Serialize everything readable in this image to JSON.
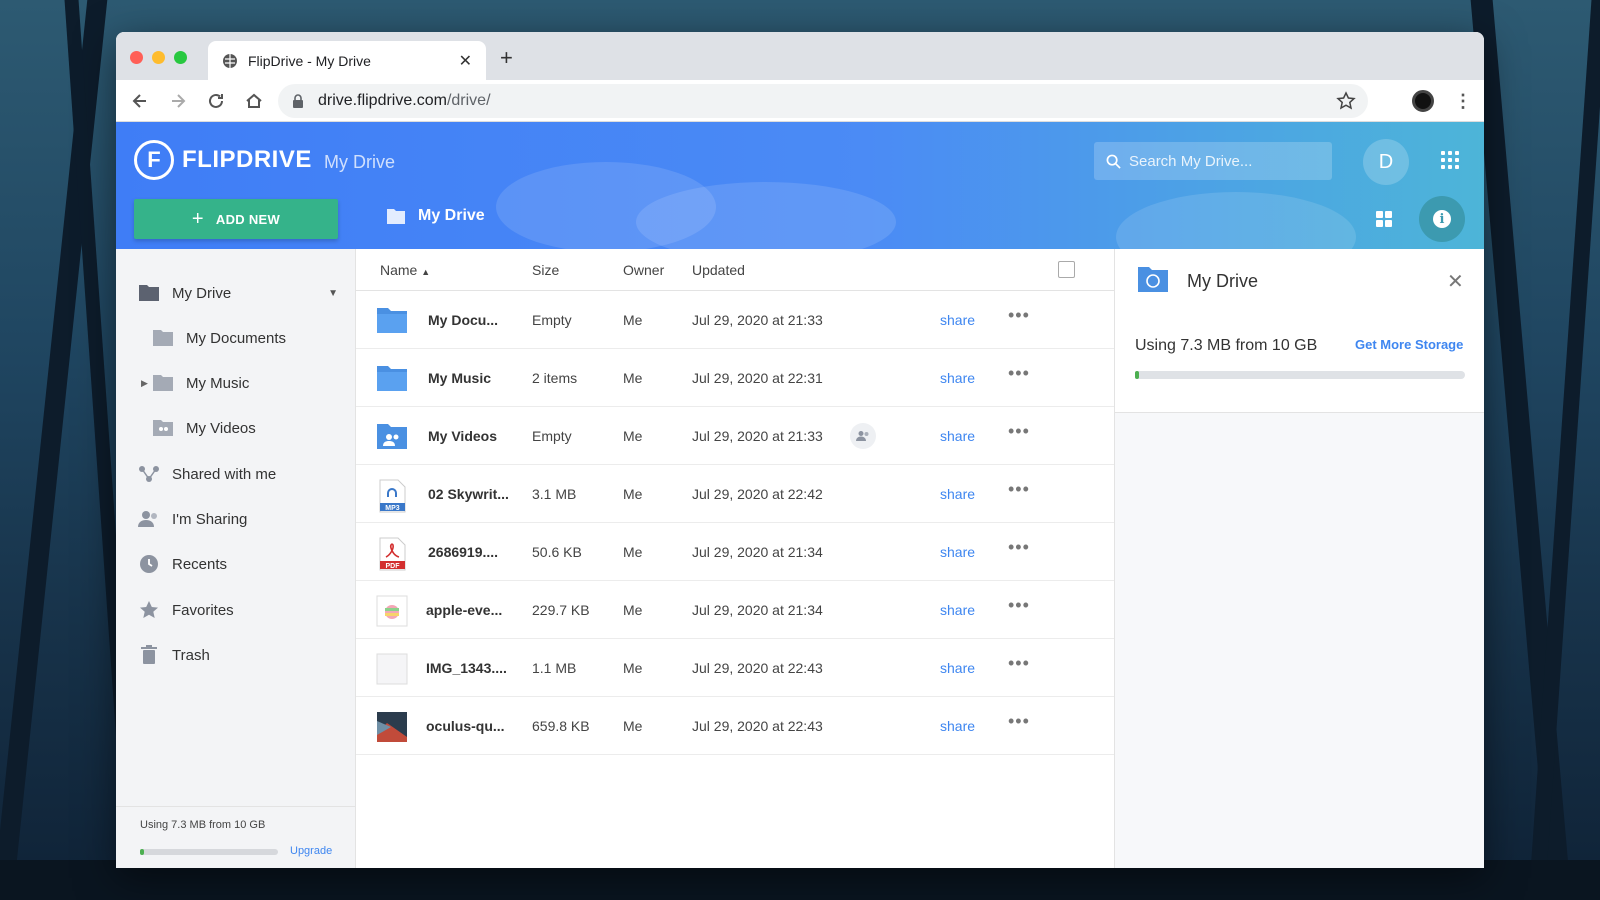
{
  "browser": {
    "tab_title": "FlipDrive - My Drive",
    "url_host": "drive.flipdrive.com",
    "url_path": "/drive/"
  },
  "app": {
    "logo_text": "FLIPDRIVE",
    "logo_glyph": "F",
    "header_title": "My Drive",
    "search_placeholder": "Search My Drive...",
    "user_initial": "D",
    "add_new_label": "ADD NEW",
    "breadcrumb": "My Drive"
  },
  "sidebar": {
    "items": [
      {
        "label": "My Drive",
        "icon": "folder-icon"
      },
      {
        "label": "My Documents",
        "icon": "folder-icon"
      },
      {
        "label": "My Music",
        "icon": "folder-icon"
      },
      {
        "label": "My Videos",
        "icon": "shared-folder-icon"
      },
      {
        "label": "Shared with me",
        "icon": "share-icon"
      },
      {
        "label": "I'm Sharing",
        "icon": "people-icon"
      },
      {
        "label": "Recents",
        "icon": "clock-icon"
      },
      {
        "label": "Favorites",
        "icon": "star-icon"
      },
      {
        "label": "Trash",
        "icon": "trash-icon"
      }
    ],
    "storage_text": "Using 7.3 MB from 10 GB",
    "storage_fraction": 0.03,
    "upgrade_label": "Upgrade"
  },
  "table": {
    "columns": {
      "name": "Name",
      "size": "Size",
      "owner": "Owner",
      "updated": "Updated"
    },
    "share_label": "share",
    "more_label": "•••",
    "rows": [
      {
        "name": "My Docu...",
        "size": "Empty",
        "owner": "Me",
        "updated": "Jul 29, 2020 at 21:33",
        "type": "folder"
      },
      {
        "name": "My Music",
        "size": "2 items",
        "owner": "Me",
        "updated": "Jul 29, 2020 at 22:31",
        "type": "folder"
      },
      {
        "name": "My Videos",
        "size": "Empty",
        "owner": "Me",
        "updated": "Jul 29, 2020 at 21:33",
        "type": "shared-folder"
      },
      {
        "name": "02 Skywrit...",
        "size": "3.1 MB",
        "owner": "Me",
        "updated": "Jul 29, 2020 at 22:42",
        "type": "mp3"
      },
      {
        "name": "2686919....",
        "size": "50.6 KB",
        "owner": "Me",
        "updated": "Jul 29, 2020 at 21:34",
        "type": "pdf"
      },
      {
        "name": "apple-eve...",
        "size": "229.7 KB",
        "owner": "Me",
        "updated": "Jul 29, 2020 at 21:34",
        "type": "image-apple"
      },
      {
        "name": "IMG_1343....",
        "size": "1.1 MB",
        "owner": "Me",
        "updated": "Jul 29, 2020 at 22:43",
        "type": "image-blank"
      },
      {
        "name": "oculus-qu...",
        "size": "659.8 KB",
        "owner": "Me",
        "updated": "Jul 29, 2020 at 22:43",
        "type": "image-photo"
      }
    ]
  },
  "panel": {
    "title": "My Drive",
    "usage_text": "Using 7.3 MB from 10 GB",
    "get_more_label": "Get More Storage",
    "usage_fraction": 0.012
  },
  "icon_labels": {
    "mp3": "MP3",
    "pdf": "PDF",
    "info": "i",
    "plus": "+",
    "close": "✕"
  },
  "colors": {
    "accent": "#3e86f0",
    "add_new": "#35b38a",
    "folder": "#4a90e2",
    "storage": "#4caf50"
  }
}
